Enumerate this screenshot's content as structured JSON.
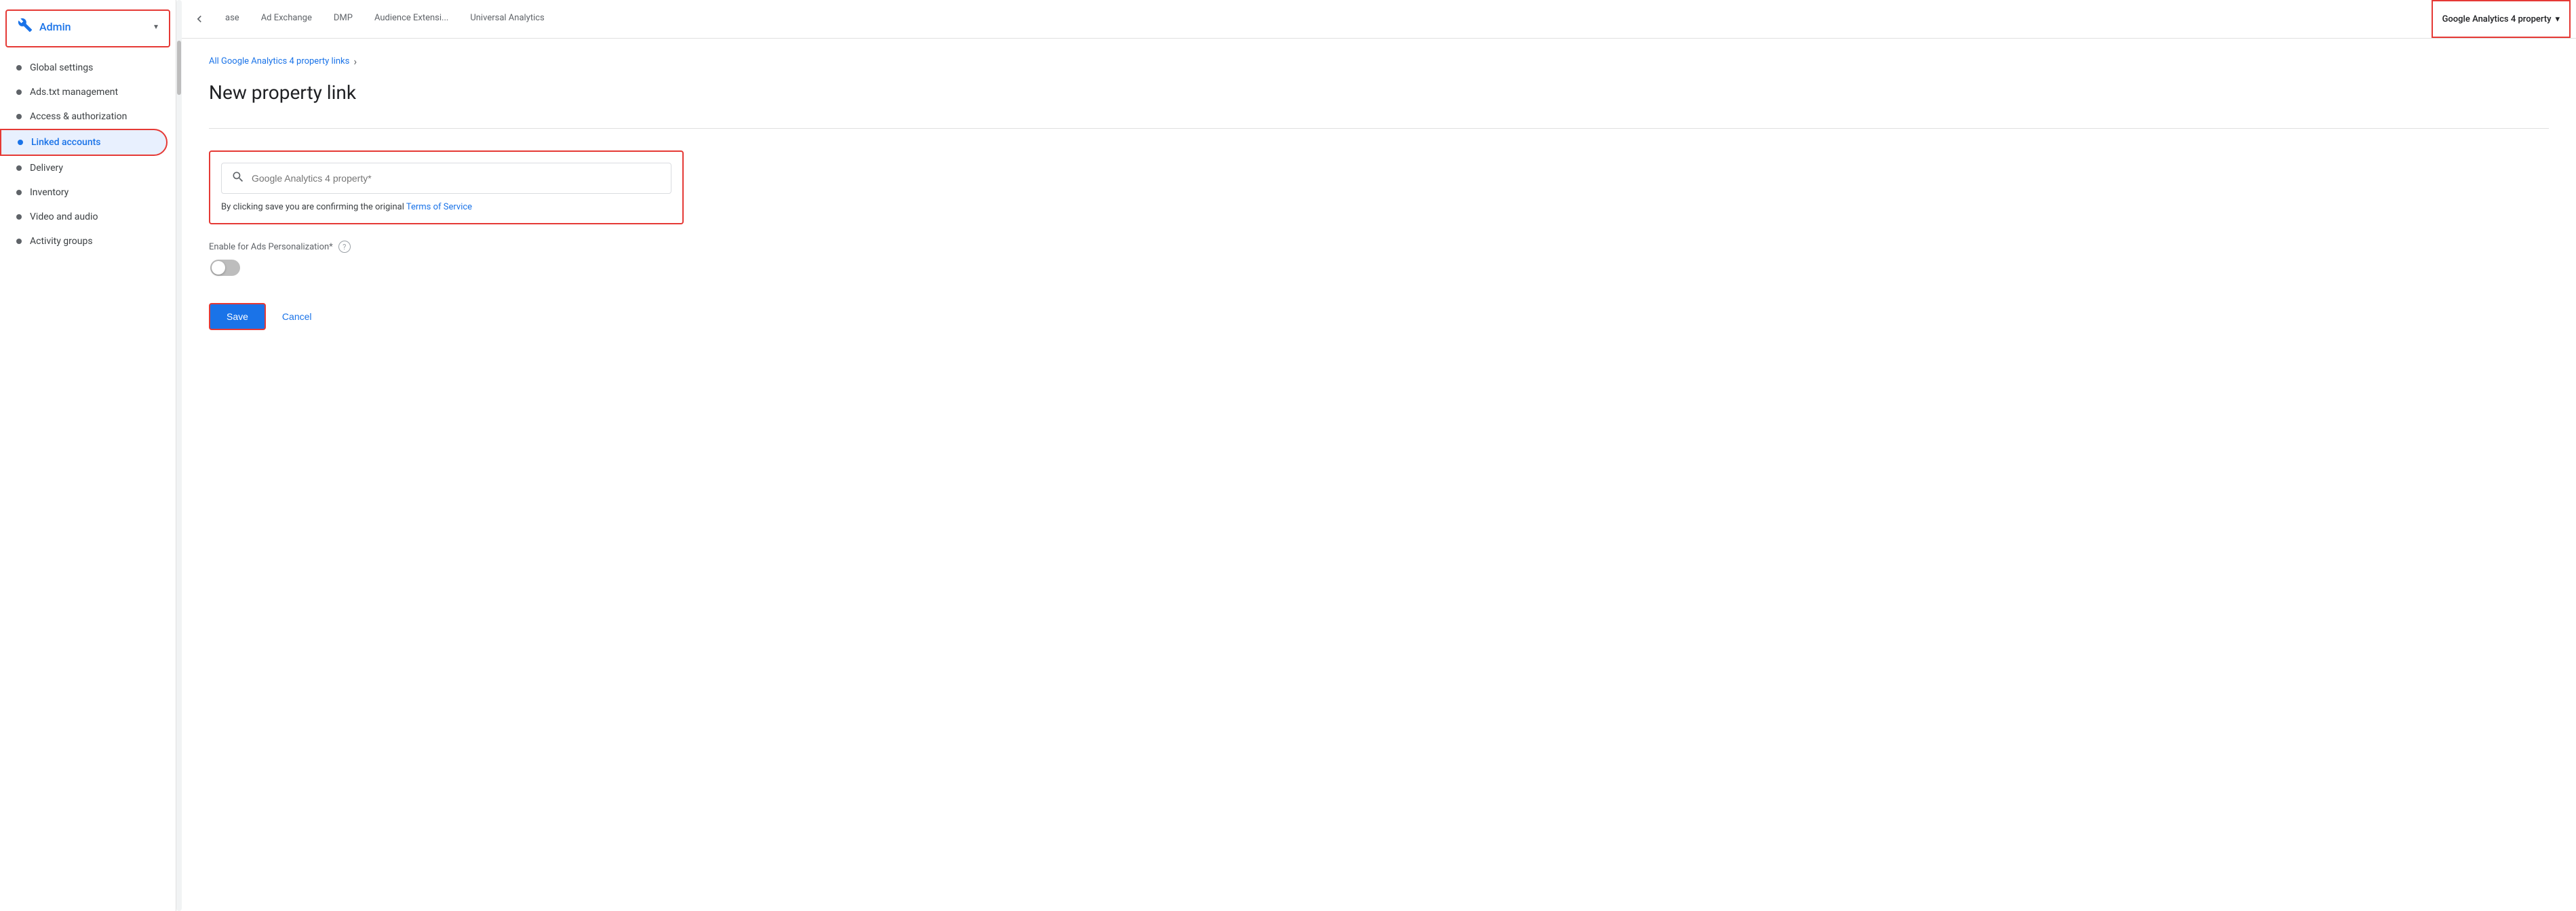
{
  "admin": {
    "title": "Admin",
    "icon": "wrench"
  },
  "sidebar": {
    "items": [
      {
        "id": "global-settings",
        "label": "Global settings",
        "active": false
      },
      {
        "id": "ads-txt",
        "label": "Ads.txt management",
        "active": false
      },
      {
        "id": "access-auth",
        "label": "Access & authorization",
        "active": false
      },
      {
        "id": "linked-accounts",
        "label": "Linked accounts",
        "active": true
      },
      {
        "id": "delivery",
        "label": "Delivery",
        "active": false
      },
      {
        "id": "inventory",
        "label": "Inventory",
        "active": false
      },
      {
        "id": "video-audio",
        "label": "Video and audio",
        "active": false
      },
      {
        "id": "activity-groups",
        "label": "Activity groups",
        "active": false
      }
    ]
  },
  "top_nav": {
    "back_button": "‹",
    "tabs": [
      {
        "id": "ase",
        "label": "ase"
      },
      {
        "id": "ad-exchange",
        "label": "Ad Exchange"
      },
      {
        "id": "dmp",
        "label": "DMP"
      },
      {
        "id": "audience-extensi",
        "label": "Audience Extensi..."
      },
      {
        "id": "universal-analytics",
        "label": "Universal Analytics"
      }
    ],
    "dropdown": {
      "label": "Google Analytics 4 property",
      "active": true
    }
  },
  "content": {
    "breadcrumb": {
      "link_text": "All Google Analytics 4 property links",
      "separator": "›"
    },
    "page_title": "New property link",
    "search_placeholder": "Google Analytics 4 property*",
    "tos_text_before": "By clicking save you are confirming the original ",
    "tos_link_text": "Terms of Service",
    "ads_personalization_label": "Enable for Ads Personalization*",
    "save_label": "Save",
    "cancel_label": "Cancel"
  }
}
